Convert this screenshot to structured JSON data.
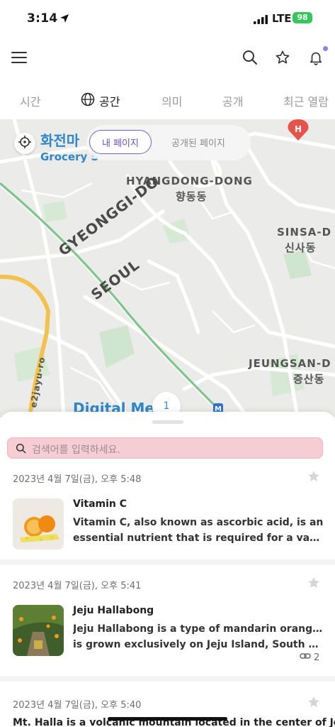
{
  "status": {
    "time": "3:14",
    "network": "LTE",
    "battery": "98"
  },
  "header": {
    "icons": [
      "menu-icon",
      "search-icon",
      "star-icon",
      "bell-icon"
    ]
  },
  "tabs": [
    {
      "label": "시간"
    },
    {
      "label": "공간",
      "icon": "globe-icon",
      "active": true
    },
    {
      "label": "의미"
    },
    {
      "label": "공개"
    },
    {
      "label": "최근 열람"
    }
  ],
  "map": {
    "segment": {
      "mine": "내 페이지",
      "public": "공개된 페이지"
    },
    "labels": {
      "place_kor": "화전마",
      "place_eng": "Grocery S",
      "hyangdong_eng": "HYANGDONG-DONG",
      "hyangdong_kor": "향동동",
      "gyeonggi": "GYEONGGI-DO",
      "seoul": "SEOUL",
      "sinsa_eng": "SINSA-D",
      "sinsa_kor": "신사동",
      "jeungsan_eng": "JEUNGSAN-D",
      "jeungsan_kor": "증산동",
      "road": "e2jayu-ro",
      "digital": "Digital Me",
      "hospital_marker": "H",
      "subway_marker": "M"
    },
    "cluster_count": "1"
  },
  "search": {
    "placeholder": "검색어를 입력하세요."
  },
  "entries": [
    {
      "date": "2023년 4월 7일(금), 오후 5:48",
      "title": "Vitamin C",
      "desc_lines": [
        "Vitamin C, also known as ascorbic acid, is an",
        "essential nutrient that is required for a variety o..."
      ]
    },
    {
      "date": "2023년 4월 7일(금), 오후 5:41",
      "title": "Jeju Hallabong",
      "desc_lines": [
        "Jeju Hallabong is a type of mandarin orange that",
        "is grown exclusively on Jeju Island, South Korea..."
      ],
      "link_count": "2"
    },
    {
      "date": "2023년 4월 7일(금), 오후 5:40",
      "title": "Mt. Halla is a volcanic mountain located in the center of Jeju"
    }
  ],
  "colors": {
    "accent": "#7a60d6",
    "search_bg": "#f5cdd3",
    "map_bg": "#ebebe9",
    "road_green": "#7cc58a",
    "road_yellow": "#f2c14e"
  }
}
